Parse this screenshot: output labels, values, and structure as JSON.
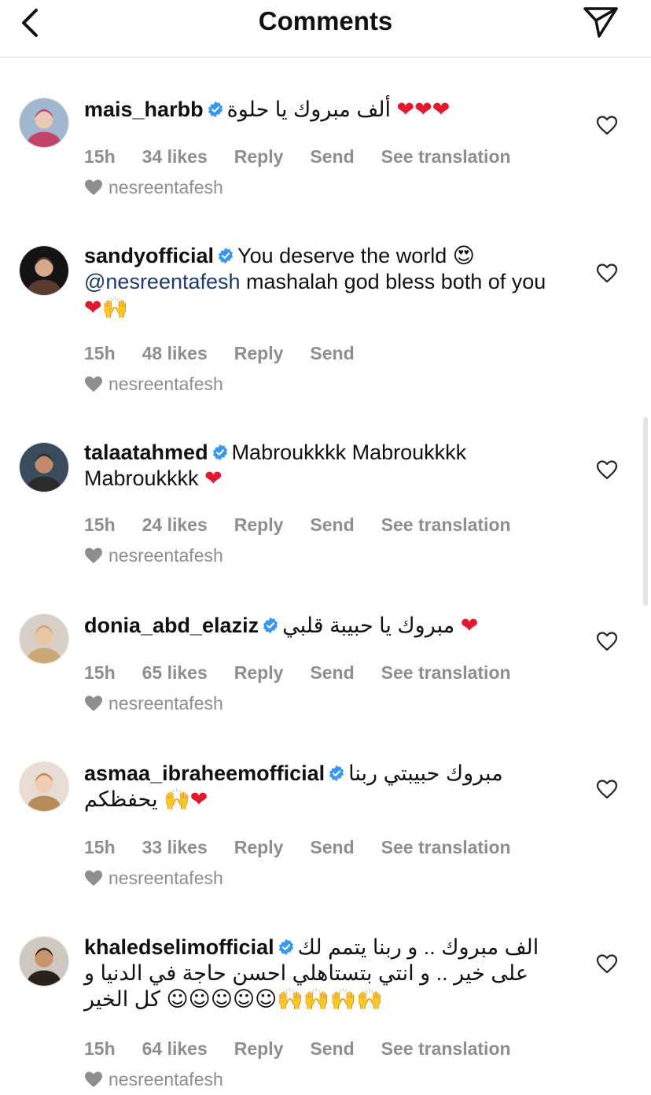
{
  "header": {
    "title": "Comments"
  },
  "comments": [
    {
      "user": "mais_harbb",
      "parts": [
        {
          "t": "ألف مبروك يا حلوة "
        },
        {
          "t": "❤❤❤",
          "c": "heart"
        }
      ],
      "time": "15h",
      "likes": "34 likes",
      "reply": "Reply",
      "send": "Send",
      "translation": "See translation",
      "liked_by": "nesreentafesh"
    },
    {
      "user": "sandyofficial",
      "parts": [
        {
          "t": "You deserve the world "
        },
        {
          "t": "😍",
          "c": "emo"
        },
        {
          "t": " "
        },
        {
          "t": "@nesreentafesh",
          "c": "mention"
        },
        {
          "t": "  mashalah god bless both of you "
        },
        {
          "t": "❤",
          "c": "heart"
        },
        {
          "t": "🙌",
          "c": "emo"
        }
      ],
      "time": "15h",
      "likes": "48 likes",
      "reply": "Reply",
      "send": "Send",
      "liked_by": "nesreentafesh"
    },
    {
      "user": "talaatahmed",
      "parts": [
        {
          "t": "Mabroukkkk Mabroukkkk Mabroukkkk "
        },
        {
          "t": "❤",
          "c": "heart"
        }
      ],
      "time": "15h",
      "likes": "24 likes",
      "reply": "Reply",
      "send": "Send",
      "translation": "See translation",
      "liked_by": "nesreentafesh"
    },
    {
      "user": "donia_abd_elaziz",
      "parts": [
        {
          "t": "مبروك يا حبيبة قلبي "
        },
        {
          "t": "❤",
          "c": "heart"
        }
      ],
      "time": "15h",
      "likes": "65 likes",
      "reply": "Reply",
      "send": "Send",
      "translation": "See translation",
      "liked_by": "nesreentafesh"
    },
    {
      "user": "asmaa_ibraheemofficial",
      "parts": [
        {
          "t": "مبروك حبيبتي ربنا يحفظكم "
        },
        {
          "t": "🙌",
          "c": "emo"
        },
        {
          "t": "❤",
          "c": "heart"
        }
      ],
      "time": "15h",
      "likes": "33 likes",
      "reply": "Reply",
      "send": "Send",
      "translation": "See translation",
      "liked_by": "nesreentafesh"
    },
    {
      "user": "khaledselimofficial",
      "parts": [
        {
          "t": "الف مبروك .. و ربنا يتمم لك على خير .. و انتي بتستاهلي احسن حاجة في الدنيا و كل الخير "
        },
        {
          "t": "☺☺☺☺☺🙌🙌🙌🙌",
          "c": "emo"
        }
      ],
      "time": "15h",
      "likes": "64 likes",
      "reply": "Reply",
      "send": "Send",
      "translation": "See translation",
      "liked_by": "nesreentafesh"
    }
  ]
}
